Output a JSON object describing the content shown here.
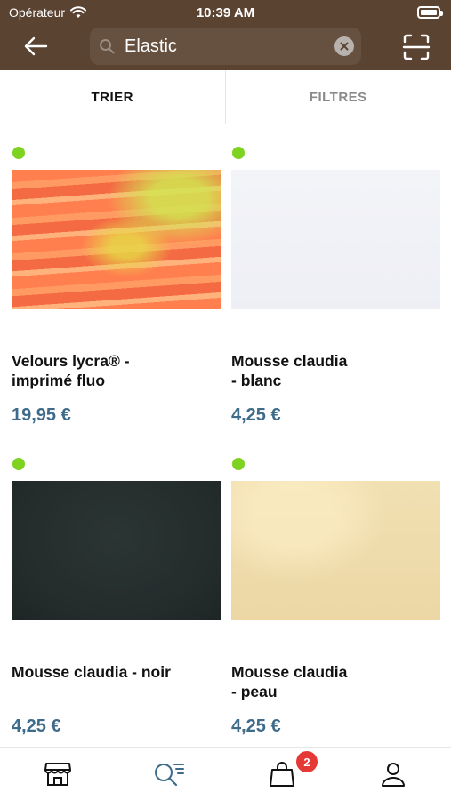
{
  "status": {
    "carrier": "Opérateur",
    "time": "10:39 AM"
  },
  "search": {
    "query": "Elastic"
  },
  "tabs": {
    "sort_label": "TRIER",
    "filter_label": "FILTRES"
  },
  "products": [
    {
      "name": "Velours lycra® -\nimprimé fluo",
      "price": "19,95 €",
      "stock": "in-stock",
      "image": "orange-fluo-fabric"
    },
    {
      "name": "Mousse claudia\n- blanc",
      "price": "4,25 €",
      "stock": "in-stock",
      "image": "white-fabric"
    },
    {
      "name": "Mousse claudia - noir",
      "price": "4,25 €",
      "stock": "in-stock",
      "image": "black-fabric"
    },
    {
      "name": "Mousse claudia\n- peau",
      "price": "4,25 €",
      "stock": "in-stock",
      "image": "beige-fabric"
    }
  ],
  "bottom_nav": {
    "cart_count": "2",
    "items": [
      "store-icon",
      "search-list-icon",
      "bag-icon",
      "user-icon"
    ]
  },
  "colors": {
    "header": "#5b4332",
    "price": "#3f6b8a",
    "stock_dot": "#7ed321",
    "badge": "#e53935",
    "active_tab_icon": "#3f6b8a"
  }
}
